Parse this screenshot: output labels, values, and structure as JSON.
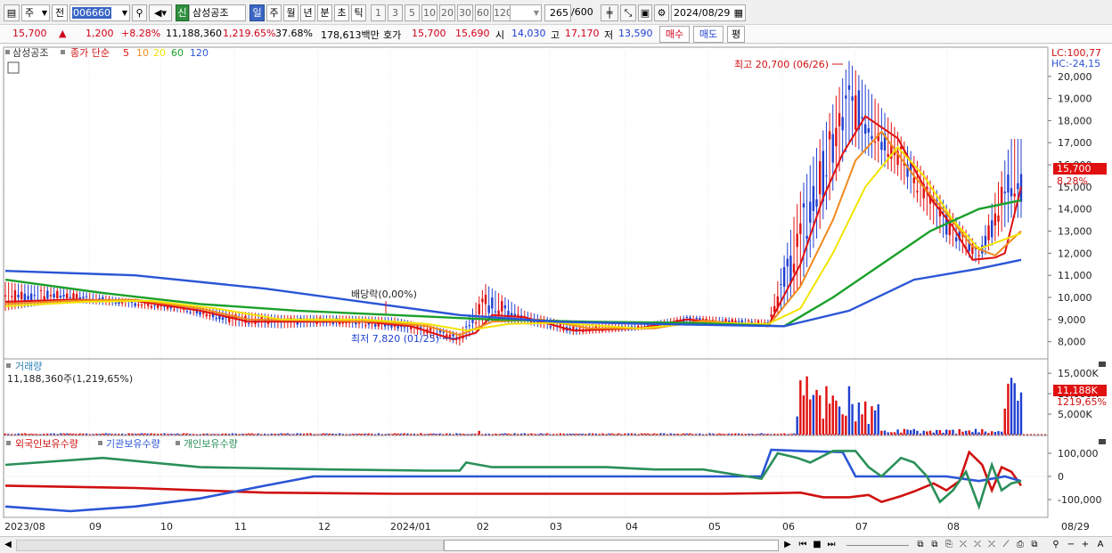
{
  "toolbar": {
    "market": "주",
    "prev": "전",
    "code": "006660",
    "search_icon": "magnifier-icon",
    "new_label": "신",
    "name": "삼성공조",
    "periods": [
      "일",
      "주",
      "월",
      "년",
      "분",
      "초",
      "틱"
    ],
    "period_selected": "일",
    "intervals": [
      "1",
      "3",
      "5",
      "10",
      "20",
      "30",
      "60",
      "120"
    ],
    "count": "265",
    "count_total": "/600",
    "date": "2024/08/29"
  },
  "quote": {
    "price": "15,700",
    "arrow": "▲",
    "change": "1,200",
    "change_pct": "+8.28%",
    "volume": "11,188,360",
    "volume_pct": "1,219.65%",
    "turnover": "37.68%",
    "amount": "178,613백만",
    "hoga_label": "호가",
    "ask": "15,700",
    "bid": "15,690",
    "open_label": "시",
    "open": "14,030",
    "high_label": "고",
    "high": "17,170",
    "low_label": "저",
    "low": "13,590",
    "buy": "매수",
    "sell": "매도",
    "eval": "평"
  },
  "legend": {
    "stock": "삼성공조",
    "ma_label": "종가 단순",
    "ma": [
      "5",
      "10",
      "20",
      "60",
      "120"
    ],
    "ma_colors": [
      "#e01010",
      "#f08a1e",
      "#f2e400",
      "#1aa02a",
      "#2a55d6"
    ],
    "lc": "LC:100,77",
    "hc": "HC:-24,15"
  },
  "annotations": {
    "high": "최고 20,700 (06/26)",
    "low": "최저 7,820 (01/25)",
    "dividend": "배당락(0,00%)",
    "last_price": "15,700",
    "last_pct": "8,28%"
  },
  "volume_panel": {
    "title": "거래량",
    "value": "11,188,360주(1,219,65%)",
    "ticks": [
      "15,000K",
      "10,000K",
      "5,000K"
    ],
    "last": "11,188K",
    "last_pct": "1219,65%"
  },
  "holdings_panel": {
    "legend": [
      "외국인보유수량",
      "기관보유수량",
      "개인보유수량"
    ],
    "legend_colors": [
      "#d01010",
      "#2a55d6",
      "#2a8f5a"
    ],
    "ticks": [
      "100,000",
      "0",
      "-100,000"
    ]
  },
  "chart_data": {
    "type": "line",
    "price_axis": [
      "20,000",
      "19,000",
      "18,000",
      "17,000",
      "16,000",
      "15,000",
      "14,000",
      "13,000",
      "12,000",
      "11,000",
      "10,000",
      "9,000",
      "8,000"
    ],
    "x_labels": [
      "2023/08",
      "09",
      "10",
      "11",
      "12",
      "2024/01",
      "02",
      "03",
      "04",
      "05",
      "06",
      "07",
      "08",
      "08/29"
    ],
    "ylim": [
      7300,
      21200
    ],
    "price_range": [
      {
        "x": 0,
        "low": 9400,
        "high": 10700
      },
      {
        "x": 18,
        "low": 9800,
        "high": 10400
      },
      {
        "x": 35,
        "low": 9600,
        "high": 10000
      },
      {
        "x": 55,
        "low": 9300,
        "high": 9700
      },
      {
        "x": 70,
        "low": 8700,
        "high": 9400
      },
      {
        "x": 85,
        "low": 8600,
        "high": 9200
      },
      {
        "x": 100,
        "low": 8700,
        "high": 9200
      },
      {
        "x": 120,
        "low": 8500,
        "high": 9100
      },
      {
        "x": 135,
        "low": 8100,
        "high": 8600
      },
      {
        "x": 140,
        "low": 7820,
        "high": 8400
      },
      {
        "x": 148,
        "low": 8900,
        "high": 10600
      },
      {
        "x": 160,
        "low": 8800,
        "high": 9400
      },
      {
        "x": 175,
        "low": 8300,
        "high": 8800
      },
      {
        "x": 195,
        "low": 8500,
        "high": 8800
      },
      {
        "x": 210,
        "low": 8800,
        "high": 9200
      },
      {
        "x": 235,
        "low": 8700,
        "high": 9000
      },
      {
        "x": 245,
        "low": 10500,
        "high": 14800
      },
      {
        "x": 260,
        "low": 17000,
        "high": 20700
      },
      {
        "x": 275,
        "low": 15500,
        "high": 17500
      },
      {
        "x": 290,
        "low": 12500,
        "high": 14200
      },
      {
        "x": 300,
        "low": 11500,
        "high": 12300
      },
      {
        "x": 310,
        "low": 13600,
        "high": 17170
      }
    ],
    "series": [
      {
        "name": "5",
        "values": [
          [
            0,
            9800
          ],
          [
            20,
            9900
          ],
          [
            40,
            9850
          ],
          [
            60,
            9400
          ],
          [
            75,
            8900
          ],
          [
            90,
            8900
          ],
          [
            110,
            8900
          ],
          [
            125,
            8700
          ],
          [
            138,
            8100
          ],
          [
            145,
            8400
          ],
          [
            150,
            9200
          ],
          [
            160,
            9100
          ],
          [
            175,
            8500
          ],
          [
            195,
            8600
          ],
          [
            210,
            9000
          ],
          [
            235,
            8700
          ],
          [
            245,
            11500
          ],
          [
            252,
            14500
          ],
          [
            258,
            16500
          ],
          [
            265,
            18200
          ],
          [
            275,
            17200
          ],
          [
            285,
            14500
          ],
          [
            292,
            13200
          ],
          [
            298,
            11700
          ],
          [
            305,
            11800
          ],
          [
            308,
            12000
          ],
          [
            313,
            15000
          ]
        ]
      },
      {
        "name": "10",
        "values": [
          [
            0,
            9700
          ],
          [
            20,
            9850
          ],
          [
            40,
            9900
          ],
          [
            60,
            9500
          ],
          [
            75,
            9000
          ],
          [
            95,
            8950
          ],
          [
            115,
            8900
          ],
          [
            130,
            8700
          ],
          [
            140,
            8300
          ],
          [
            150,
            8900
          ],
          [
            165,
            9000
          ],
          [
            180,
            8600
          ],
          [
            200,
            8600
          ],
          [
            215,
            8950
          ],
          [
            235,
            8700
          ],
          [
            245,
            10500
          ],
          [
            255,
            13500
          ],
          [
            262,
            16200
          ],
          [
            270,
            17500
          ],
          [
            280,
            15500
          ],
          [
            290,
            13800
          ],
          [
            298,
            12300
          ],
          [
            305,
            11900
          ],
          [
            313,
            13000
          ]
        ]
      },
      {
        "name": "20",
        "values": [
          [
            0,
            9600
          ],
          [
            25,
            9800
          ],
          [
            45,
            9850
          ],
          [
            65,
            9500
          ],
          [
            85,
            9000
          ],
          [
            110,
            9000
          ],
          [
            130,
            8800
          ],
          [
            142,
            8500
          ],
          [
            155,
            8800
          ],
          [
            170,
            8850
          ],
          [
            195,
            8600
          ],
          [
            215,
            8850
          ],
          [
            235,
            8800
          ],
          [
            245,
            9500
          ],
          [
            255,
            12000
          ],
          [
            265,
            15000
          ],
          [
            275,
            16800
          ],
          [
            283,
            15500
          ],
          [
            292,
            13500
          ],
          [
            300,
            12200
          ],
          [
            313,
            12900
          ]
        ]
      },
      {
        "name": "60",
        "values": [
          [
            0,
            10800
          ],
          [
            30,
            10200
          ],
          [
            60,
            9700
          ],
          [
            90,
            9400
          ],
          [
            120,
            9200
          ],
          [
            150,
            9000
          ],
          [
            180,
            8900
          ],
          [
            210,
            8850
          ],
          [
            240,
            8700
          ],
          [
            255,
            10000
          ],
          [
            270,
            11500
          ],
          [
            285,
            13000
          ],
          [
            300,
            14000
          ],
          [
            313,
            14400
          ]
        ]
      },
      {
        "name": "120",
        "values": [
          [
            0,
            11200
          ],
          [
            40,
            11000
          ],
          [
            80,
            10400
          ],
          [
            110,
            9800
          ],
          [
            140,
            9200
          ],
          [
            170,
            8900
          ],
          [
            200,
            8800
          ],
          [
            240,
            8700
          ],
          [
            260,
            9400
          ],
          [
            280,
            10800
          ],
          [
            300,
            11300
          ],
          [
            313,
            11700
          ]
        ]
      }
    ]
  }
}
